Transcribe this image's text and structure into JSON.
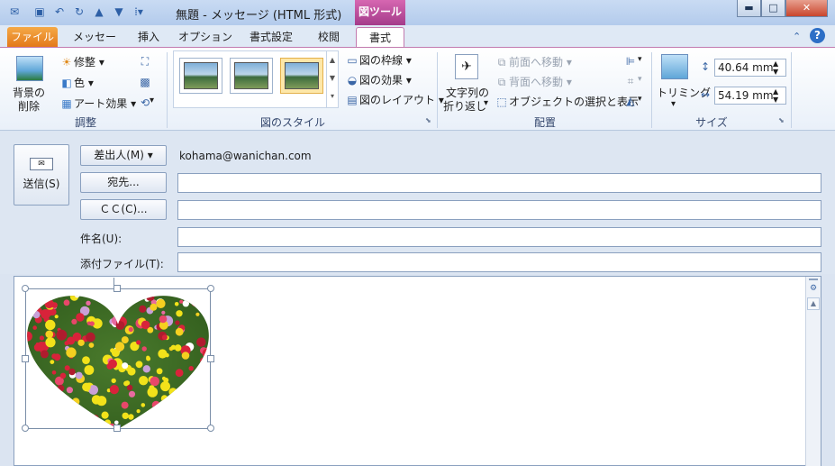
{
  "window": {
    "title": "無題 - メッセージ (HTML 形式)",
    "context_tab_group": "図ツール",
    "controls": [
      "minimize",
      "maximize",
      "close"
    ]
  },
  "tabs": [
    {
      "label": "ファイル"
    },
    {
      "label": "メッセージ"
    },
    {
      "label": "挿入"
    },
    {
      "label": "オプション"
    },
    {
      "label": "書式設定"
    },
    {
      "label": "校閲"
    },
    {
      "label": "書式"
    }
  ],
  "ribbon": {
    "adjust": {
      "label": "調整",
      "remove_bg": "背景の\n削除",
      "remove_bg_l1": "背景の",
      "remove_bg_l2": "削除",
      "corrections": "修整",
      "color": "色",
      "art_effects": "アート効果"
    },
    "styles": {
      "label": "図のスタイル",
      "border": "図の枠線",
      "effects": "図の効果",
      "layout": "図のレイアウト"
    },
    "arrange": {
      "label": "配置",
      "wrap_l1": "文字列の",
      "wrap_l2": "折り返し",
      "bring_forward": "前面へ移動",
      "send_backward": "背面へ移動",
      "selection_pane": "オブジェクトの選択と表示"
    },
    "size": {
      "label": "サイズ",
      "crop": "トリミング",
      "height": "40.64 mm",
      "width": "54.19 mm"
    }
  },
  "form": {
    "send": "送信(S)",
    "from_button": "差出人(M)",
    "from_value": "kohama@wanichan.com",
    "to_button": "宛先...",
    "cc_button": "ＣＣ(C)...",
    "subject_label": "件名(U):",
    "attach_label": "添付ファイル(T):",
    "to_value": "",
    "cc_value": "",
    "subject_value": "",
    "attach_value": ""
  },
  "colors": {
    "accent_context": "#a43b8a",
    "file_tab": "#e3791a",
    "ribbon_bg": "#ffffff"
  }
}
